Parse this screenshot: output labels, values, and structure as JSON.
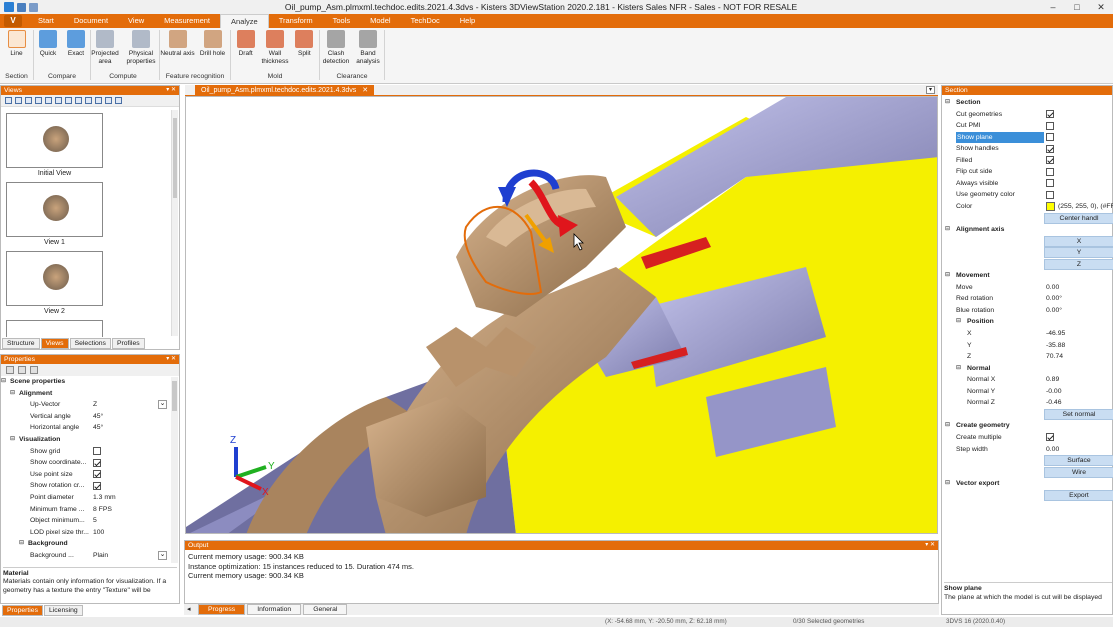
{
  "app": {
    "title": "Oil_pump_Asm.plmxml.techdoc.edits.2021.4.3dvs - Kisters 3DViewStation 2020.2.181 - Kisters Sales NFR - Sales - NOT FOR RESALE",
    "app_menu": "V",
    "window_buttons": {
      "minimize": "–",
      "maximize": "□",
      "close": "✕"
    }
  },
  "menu_tabs": [
    "Start",
    "Document",
    "View",
    "Measurement",
    "Analyze",
    "Transform",
    "Tools",
    "Model",
    "TechDoc",
    "Help"
  ],
  "active_tab": "Analyze",
  "ribbon": {
    "groups": [
      {
        "label": "Section",
        "buttons": [
          {
            "label": "Line",
            "icon": "section-line-icon"
          }
        ]
      },
      {
        "label": "Compare",
        "buttons": [
          {
            "label": "Quick",
            "icon": "quick-compare-icon"
          },
          {
            "label": "Exact",
            "icon": "exact-compare-icon"
          }
        ]
      },
      {
        "label": "Compute",
        "buttons": [
          {
            "label": "Projected area",
            "icon": "projected-area-icon"
          },
          {
            "label": "Physical properties",
            "icon": "physical-properties-icon"
          }
        ]
      },
      {
        "label": "Feature recognition",
        "buttons": [
          {
            "label": "Neutral axis",
            "icon": "neutral-axis-icon"
          },
          {
            "label": "Drill hole",
            "icon": "drill-hole-icon"
          }
        ]
      },
      {
        "label": "Mold",
        "buttons": [
          {
            "label": "Draft",
            "icon": "draft-icon"
          },
          {
            "label": "Wall thickness",
            "icon": "wall-thickness-icon"
          },
          {
            "label": "Split",
            "icon": "split-icon"
          }
        ]
      },
      {
        "label": "Clearance",
        "buttons": [
          {
            "label": "Clash detection",
            "icon": "clash-detection-icon"
          },
          {
            "label": "Band analysis",
            "icon": "band-analysis-icon"
          }
        ]
      }
    ]
  },
  "views_panel": {
    "title": "Views",
    "thumbnails": [
      {
        "caption": "Initial View"
      },
      {
        "caption": "View 1"
      },
      {
        "caption": "View 2"
      }
    ],
    "tabs": [
      "Structure",
      "Views",
      "Selections",
      "Profiles"
    ],
    "active_tab": "Views"
  },
  "properties_panel": {
    "title": "Properties",
    "rows": [
      {
        "type": "section",
        "label": "Scene properties",
        "indent": 0
      },
      {
        "type": "section",
        "label": "Alignment",
        "indent": 1
      },
      {
        "type": "value",
        "label": "Up-Vector",
        "value": "Z",
        "dropdown": true
      },
      {
        "type": "value",
        "label": "Vertical angle",
        "value": "45°"
      },
      {
        "type": "value",
        "label": "Horizontal angle",
        "value": "45°"
      },
      {
        "type": "section",
        "label": "Visualization",
        "indent": 1
      },
      {
        "type": "check",
        "label": "Show grid",
        "checked": false
      },
      {
        "type": "check",
        "label": "Show coordinate...",
        "checked": true
      },
      {
        "type": "check",
        "label": "Use point size",
        "checked": true
      },
      {
        "type": "check",
        "label": "Show rotation cr...",
        "checked": true
      },
      {
        "type": "value",
        "label": "Point diameter",
        "value": "1.3 mm"
      },
      {
        "type": "value",
        "label": "Minimum frame ...",
        "value": "8 FPS"
      },
      {
        "type": "value",
        "label": "Object minimum...",
        "value": "5"
      },
      {
        "type": "value",
        "label": "LOD pixel size thr...",
        "value": "100"
      },
      {
        "type": "section",
        "label": "Background",
        "indent": 2
      },
      {
        "type": "value",
        "label": "Background ...",
        "value": "Plain",
        "dropdown": true
      }
    ],
    "help_title": "Material",
    "help_text": "Materials contain only information for visualization. If a geometry has a texture the entry \"Texture\" will be",
    "tabs": [
      "Properties",
      "Licensing"
    ],
    "active_tab": "Properties"
  },
  "document_tab": "Oil_pump_Asm.plmxml.techdoc.edits.2021.4.3dvs",
  "viewport": {
    "axis_labels": {
      "z": "Z",
      "y": "Y",
      "x": "X"
    },
    "colors": {
      "cut_fill": "#f5f000",
      "part": "#c9a37c",
      "part_dark": "#8a6a48",
      "steel": "#a9a9d9",
      "rotation_blue": "#1f3fd0",
      "rotation_red": "#e0151c",
      "arrow": "#f0a000"
    }
  },
  "output_panel": {
    "title": "Output",
    "lines": [
      "Current memory usage: 900.34 KB",
      "Instance optimization: 15 instances reduced to 15. Duration 474 ms.",
      "Current memory usage: 900.34 KB"
    ],
    "tabs": [
      "Progress",
      "Information",
      "General"
    ],
    "active_tab": "Progress"
  },
  "section_panel": {
    "title": "Section",
    "rows": [
      {
        "type": "section",
        "label": "Section"
      },
      {
        "type": "check",
        "label": "Cut geometries",
        "checked": true
      },
      {
        "type": "check",
        "label": "Cut PMI",
        "checked": false
      },
      {
        "type": "check",
        "label": "Show plane",
        "checked": false,
        "selected": true
      },
      {
        "type": "check",
        "label": "Show handles",
        "checked": true
      },
      {
        "type": "check",
        "label": "Filled",
        "checked": true
      },
      {
        "type": "check",
        "label": "Flip cut side",
        "checked": false
      },
      {
        "type": "check",
        "label": "Always visible",
        "checked": false
      },
      {
        "type": "check",
        "label": "Use geometry color",
        "checked": false
      },
      {
        "type": "color",
        "label": "Color",
        "value": "(255, 255, 0), (#FF"
      },
      {
        "type": "button",
        "value": "Center handl"
      },
      {
        "type": "section",
        "label": "Alignment axis"
      },
      {
        "type": "button",
        "value": "X"
      },
      {
        "type": "button",
        "value": "Y"
      },
      {
        "type": "button",
        "value": "Z"
      },
      {
        "type": "section",
        "label": "Movement"
      },
      {
        "type": "value",
        "label": "Move",
        "value": "0.00"
      },
      {
        "type": "value",
        "label": "Red rotation",
        "value": "0.00°"
      },
      {
        "type": "value",
        "label": "Blue rotation",
        "value": "0.00°"
      },
      {
        "type": "subsection",
        "label": "Position"
      },
      {
        "type": "value",
        "label": "X",
        "value": "-46.95",
        "indent": true
      },
      {
        "type": "value",
        "label": "Y",
        "value": "-35.88",
        "indent": true
      },
      {
        "type": "value",
        "label": "Z",
        "value": "70.74",
        "indent": true
      },
      {
        "type": "subsection",
        "label": "Normal"
      },
      {
        "type": "value",
        "label": "Normal X",
        "value": "0.89",
        "indent": true
      },
      {
        "type": "value",
        "label": "Normal Y",
        "value": "-0.00",
        "indent": true
      },
      {
        "type": "value",
        "label": "Normal Z",
        "value": "-0.46",
        "indent": true
      },
      {
        "type": "button",
        "value": "Set normal"
      },
      {
        "type": "section",
        "label": "Create geometry"
      },
      {
        "type": "check",
        "label": "Create multiple",
        "checked": true
      },
      {
        "type": "value",
        "label": "Step width",
        "value": "0.00"
      },
      {
        "type": "button",
        "value": "Surface"
      },
      {
        "type": "button",
        "value": "Wire"
      },
      {
        "type": "section",
        "label": "Vector export"
      },
      {
        "type": "button",
        "value": "Export"
      }
    ],
    "help_title": "Show plane",
    "help_text": "The plane at which the model is cut will be displayed"
  },
  "status_bar": {
    "coords": "(X: -54.68 mm, Y: -20.50 mm, Z: 62.18 mm)",
    "selection": "0/30 Selected geometries",
    "version": "3DVS 16 (2020.0.40)"
  }
}
